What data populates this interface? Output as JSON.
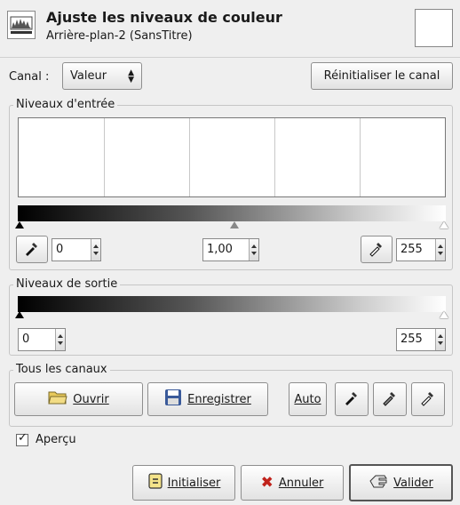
{
  "header": {
    "title": "Ajuste les niveaux de couleur",
    "subtitle": "Arrière-plan-2 (SansTitre)"
  },
  "channel": {
    "label": "Canal :",
    "value": "Valeur",
    "reset_label": "Réinitialiser le canal"
  },
  "input_levels": {
    "label": "Niveaux d'entrée",
    "low": "0",
    "gamma": "1,00",
    "high": "255"
  },
  "output_levels": {
    "label": "Niveaux de sortie",
    "low": "0",
    "high": "255"
  },
  "all_channels": {
    "label": "Tous les canaux",
    "open_label": "Ouvrir",
    "save_label": "Enregistrer",
    "auto_label": "Auto"
  },
  "preview": {
    "label": "Aperçu",
    "checked": true
  },
  "footer": {
    "reset_label": "Initialiser",
    "cancel_label": "Annuler",
    "ok_label": "Valider"
  },
  "colors": {
    "background": "#efefef",
    "cancel_x": "#c0221b",
    "open_icon": "#e8c95a",
    "save_icon": "#3a5a9a"
  }
}
